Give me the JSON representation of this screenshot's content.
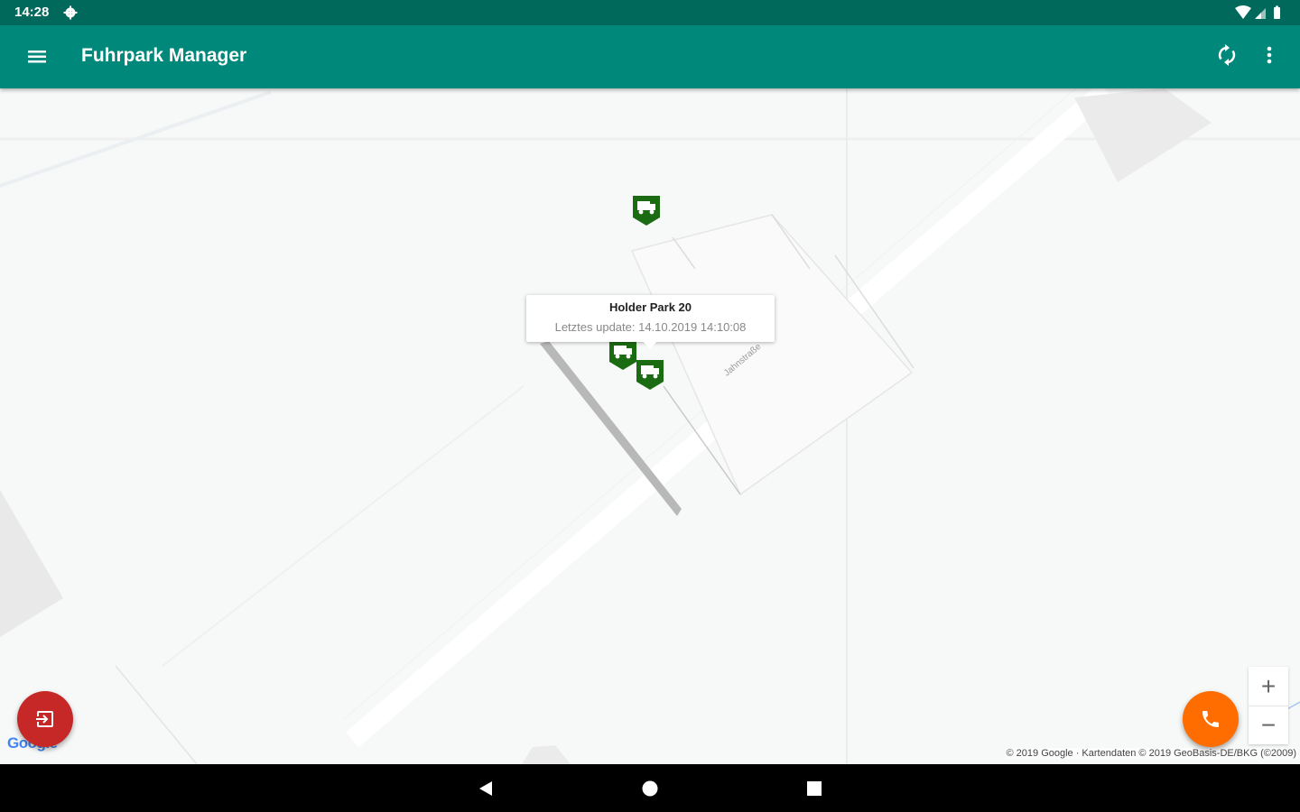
{
  "status_bar": {
    "time": "14:28",
    "icons": [
      "settings-gear-icon",
      "wifi-icon",
      "signal-icon",
      "battery-icon"
    ]
  },
  "app_bar": {
    "title": "Fuhrpark Manager",
    "icons": [
      "menu-icon",
      "sync-icon",
      "more-vert-icon"
    ]
  },
  "map": {
    "info_window": {
      "title": "Holder Park 20",
      "subtitle": "Letztes update: 14.10.2019 14:10:08"
    },
    "street_label": "Jahnstraße",
    "markers": [
      "truck-marker-icon",
      "truck-marker-icon",
      "truck-marker-icon"
    ],
    "zoom": {
      "in": "+",
      "out": "−"
    },
    "logo": "Google",
    "attribution": "© 2019 Google · Kartendaten © 2019 GeoBasis-DE/BKG (©2009)"
  },
  "fabs": {
    "logout_icon": "exit-to-app-icon",
    "call_icon": "phone-icon"
  },
  "nav_bar": [
    "back-icon",
    "home-icon",
    "recents-icon"
  ],
  "colors": {
    "status_bar": "#00695c",
    "app_bar": "#00897b",
    "marker": "#1b6b12",
    "logout_fab": "#c62828",
    "call_fab": "#ff6d00"
  }
}
